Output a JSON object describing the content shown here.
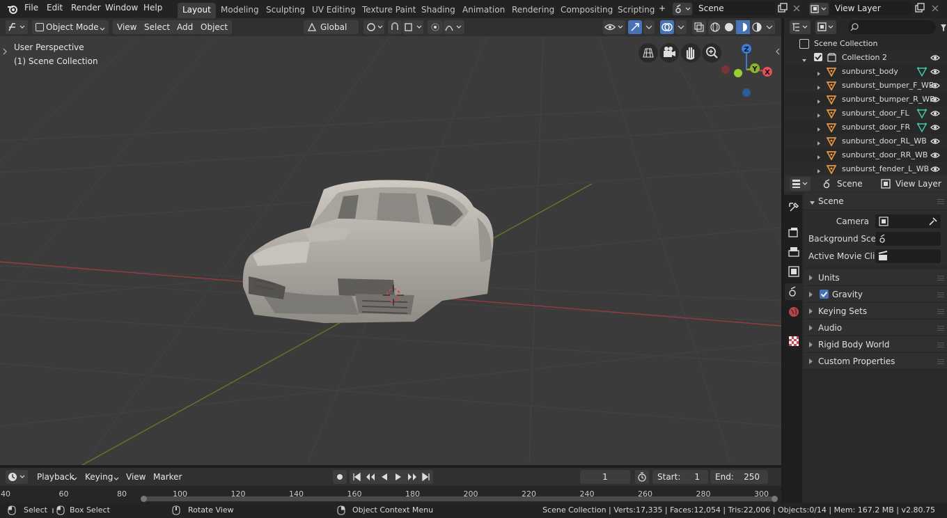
{
  "topbar": {
    "menus": [
      "File",
      "Edit",
      "Render",
      "Window",
      "Help"
    ],
    "workspaces": [
      "Layout",
      "Modeling",
      "Sculpting",
      "UV Editing",
      "Texture Paint",
      "Shading",
      "Animation",
      "Rendering",
      "Compositing",
      "Scripting"
    ],
    "active_workspace": "Layout",
    "add_tab": "+",
    "scene_name": "Scene",
    "view_layer_name": "View Layer"
  },
  "viewport_header": {
    "mode": "Object Mode",
    "menus": [
      "View",
      "Select",
      "Add",
      "Object"
    ],
    "orientation": "Global"
  },
  "viewport": {
    "perspective_label": "User Perspective",
    "collection_label": "(1) Scene Collection",
    "gizmo_axes": [
      "Z",
      "Y",
      "X"
    ]
  },
  "outliner": {
    "root": "Scene Collection",
    "collection": "Collection 2",
    "items": [
      {
        "name": "sunburst_body",
        "has_modifier": true
      },
      {
        "name": "sunburst_bumper_F_WB",
        "has_modifier": false
      },
      {
        "name": "sunburst_bumper_R_WB",
        "has_modifier": false
      },
      {
        "name": "sunburst_door_FL",
        "has_modifier": true
      },
      {
        "name": "sunburst_door_FR",
        "has_modifier": true
      },
      {
        "name": "sunburst_door_RL_WB",
        "has_modifier": false
      },
      {
        "name": "sunburst_door_RR_WB",
        "has_modifier": false
      },
      {
        "name": "sunburst_fender_L_WB",
        "has_modifier": false
      }
    ]
  },
  "properties": {
    "breadcrumb_scene": "Scene",
    "breadcrumb_view_layer": "View Layer",
    "panel_title": "Scene",
    "fields": [
      {
        "label": "Camera"
      },
      {
        "label": "Background Sce.."
      },
      {
        "label": "Active Movie Clip"
      }
    ],
    "sections": [
      "Units",
      "Gravity",
      "Keying Sets",
      "Audio",
      "Rigid Body World",
      "Custom Properties"
    ],
    "gravity_checked": true
  },
  "timeline": {
    "menus": [
      "Playback",
      "Keying",
      "View",
      "Marker"
    ],
    "current_frame": "1",
    "start_label": "Start:",
    "start_value": "1",
    "end_label": "End:",
    "end_value": "250",
    "ruler_ticks": [
      "40",
      "60",
      "80",
      "100",
      "120",
      "140",
      "160",
      "180",
      "200",
      "220",
      "240",
      "260",
      "280",
      "300"
    ]
  },
  "statusbar": {
    "select": "Select",
    "box_select": "Box Select",
    "rotate_view": "Rotate View",
    "context_menu": "Object Context Menu",
    "stats": "Scene Collection | Verts:17,335 | Faces:12,054 | Tris:22,006 | Objects:0/14 | Mem: 167.2 MB | v2.80.75"
  },
  "colors": {
    "x_axis": "#c94a53",
    "y_axis": "#8ab32c",
    "z_axis": "#3d7dd8",
    "object_orange": "#e9953f",
    "modifier_teal": "#3cc8a6"
  }
}
